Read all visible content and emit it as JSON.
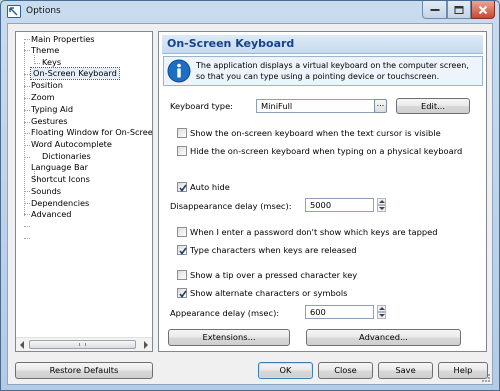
{
  "window": {
    "title": "Options"
  },
  "tree": {
    "items": [
      {
        "label": "Main Properties"
      },
      {
        "label": "Theme"
      },
      {
        "label": "Keys"
      },
      {
        "label": "On-Screen Keyboard"
      },
      {
        "label": "Position"
      },
      {
        "label": "Zoom"
      },
      {
        "label": "Typing Aid"
      },
      {
        "label": "Gestures"
      },
      {
        "label": "Floating Window for On-Screen Ke"
      },
      {
        "label": "Word Autocomplete"
      },
      {
        "label": "Dictionaries"
      },
      {
        "label": "Language Bar"
      },
      {
        "label": "Shortcut Icons"
      },
      {
        "label": "Sounds"
      },
      {
        "label": "Dependencies"
      },
      {
        "label": "Advanced"
      }
    ]
  },
  "panel": {
    "title": "On-Screen Keyboard",
    "info_text": "The application displays a virtual keyboard on the computer screen, so that you can type using a pointing device or touchscreen.",
    "keyboard_type": {
      "label": "Keyboard type:",
      "value": "MiniFull",
      "browse": "...",
      "edit_button": "Edit..."
    },
    "checks": {
      "show_on_cursor": {
        "label": "Show the on-screen keyboard when the text cursor is visible",
        "checked": false
      },
      "hide_on_physical": {
        "label": "Hide the on-screen keyboard when typing on a physical keyboard",
        "checked": false
      },
      "auto_hide": {
        "label": "Auto hide",
        "checked": true
      },
      "password": {
        "label": "When I enter a password don't show which keys are tapped",
        "checked": false
      },
      "type_on_release": {
        "label": "Type characters when keys are released",
        "checked": true
      },
      "show_tip": {
        "label": "Show a tip over a pressed character key",
        "checked": false
      },
      "show_alternate": {
        "label": "Show alternate characters or symbols",
        "checked": true
      }
    },
    "disappearance_delay": {
      "label": "Disappearance delay (msec):",
      "value": "5000"
    },
    "appearance_delay": {
      "label": "Appearance delay (msec):",
      "value": "600"
    },
    "extensions_button": "Extensions...",
    "advanced_button": "Advanced..."
  },
  "footer": {
    "restore_defaults": "Restore Defaults",
    "ok": "OK",
    "close": "Close",
    "save": "Save",
    "help": "Help"
  },
  "colors": {
    "accent": "#15428b",
    "header_bg": "#c7daee",
    "info_icon": "#1c6fc4"
  }
}
